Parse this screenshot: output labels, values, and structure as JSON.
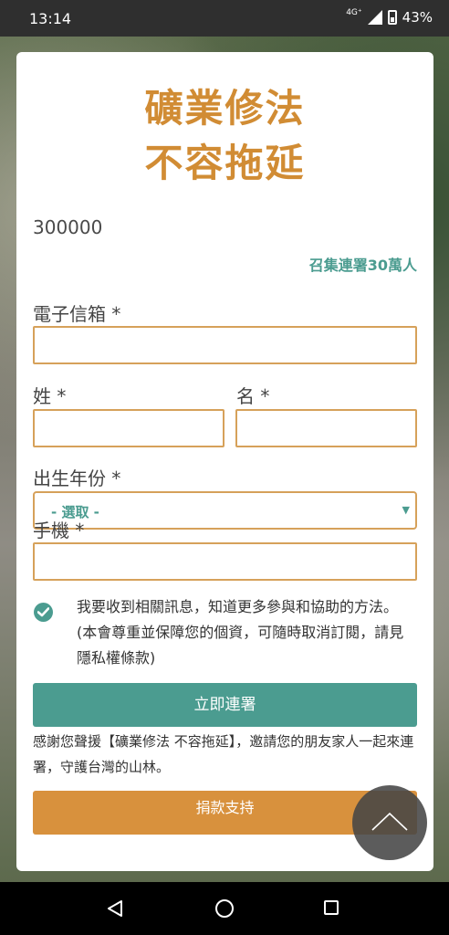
{
  "status_bar": {
    "time": "13:14",
    "network": "4G⁺",
    "battery": "43%"
  },
  "petition": {
    "title_line1": "礦業修法",
    "title_line2": "不容拖延",
    "signature_count": "300000",
    "goal_text": "召集連署30萬人"
  },
  "form": {
    "email_label": "電子信箱 *",
    "email_value": "",
    "last_name_label": "姓 *",
    "last_name_value": "",
    "first_name_label": "名 *",
    "first_name_value": "",
    "birth_year_label": "出生年份 *",
    "birth_year_selected": "- 選取 -",
    "phone_label": "手機 *",
    "phone_value": "",
    "consent_text": "我要收到相關訊息，知道更多參與和協助的方法。(本會尊重並保障您的個資，可隨時取消訂閱，請見隱私權條款)",
    "consent_checked": true
  },
  "actions": {
    "sign_label": "立即連署",
    "thanks_text": "感謝您聲援【礦業修法 不容拖延】，邀請您的朋友家人一起來連署，守護台灣的山林。",
    "donate_label": "捐款支持"
  },
  "colors": {
    "accent_orange": "#d18c34",
    "accent_teal": "#4b9c90",
    "field_border": "#d6a15a"
  },
  "icons": {
    "consent_check": "check-circle-icon",
    "scroll_top": "chevron-up-icon"
  }
}
